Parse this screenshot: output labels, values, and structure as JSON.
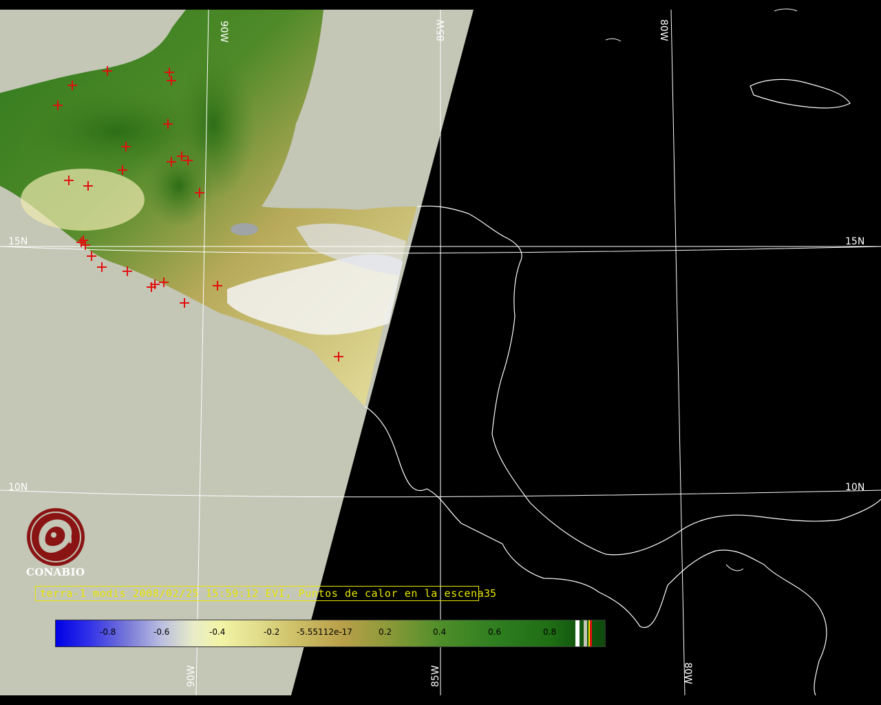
{
  "grid_labels": {
    "lon_90_top": "90W",
    "lon_85_top": "85W",
    "lon_80_top": "80W",
    "lon_90_bottom": "90W",
    "lon_85_bottom": "85W",
    "lon_80_bottom": "80W",
    "lat_15_left": "15N",
    "lat_15_right": "15N",
    "lat_10_left": "10N",
    "lat_10_right": "10N"
  },
  "logo": {
    "text": "CONABIO"
  },
  "caption": {
    "text": "terra-1 modis 2008/02/25 15:59:12 EVI, Puntos de calor en la escena",
    "count": "35"
  },
  "colorbar": {
    "ticks": [
      "-0.8",
      "-0.6",
      "-0.4",
      "-0.2",
      "-5.55112e-17",
      "0.2",
      "0.4",
      "0.6",
      "0.8"
    ],
    "colors": [
      "#0000e6",
      "#b8bce0",
      "#f3f4a6",
      "#cfc26a",
      "#8f9a3a",
      "#2f7e20",
      "#0f4a0c"
    ]
  },
  "colors": {
    "swath_background": "#c4c6b6",
    "night_background": "#000000",
    "fire_marker": "#e01010",
    "caption": "#e8e800",
    "grid": "#ffffff"
  },
  "hotspots_count_visible": 35
}
